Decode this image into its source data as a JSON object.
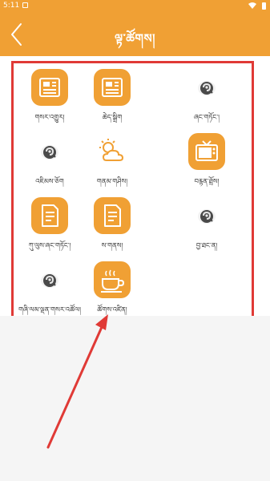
{
  "status_bar": {
    "time": "5:11"
  },
  "header": {
    "title": "ལྟ་ཚོགས།",
    "back_icon": "chevron-left-icon"
  },
  "grid": {
    "items": [
      {
        "label": "གསར་འགྱུར།",
        "icon": "newspaper-icon"
      },
      {
        "label": "ཆེད་སྒྲིག",
        "icon": "newspaper-icon"
      },
      {
        "label": "ཞང་གཏོང་།",
        "icon": "placeholder-logo-icon"
      },
      {
        "label": "འཇིམས་ཅོག",
        "icon": "placeholder-logo-icon"
      },
      {
        "label": "གནམ་གཤིས།",
        "icon": "weather-icon"
      },
      {
        "label": "བརྙན་ཐྲོས།",
        "icon": "tv-icon"
      },
      {
        "label": "ཀུ་ལུས་ཞང་གཏོང་།",
        "icon": "document-icon"
      },
      {
        "label": "ས་གནས།",
        "icon": "document-icon"
      },
      {
        "label": "བྱ་ཐང་ན།",
        "icon": "placeholder-logo-icon"
      },
      {
        "label": "གཞི་ལམ་ལྡན་གསར་འཚོལ།",
        "icon": "placeholder-logo-icon"
      },
      {
        "label": "ཚོགས་འཛིན།",
        "icon": "coffee-cup-icon"
      }
    ]
  },
  "colors": {
    "accent": "#f0a034",
    "highlight": "#e03a36"
  }
}
